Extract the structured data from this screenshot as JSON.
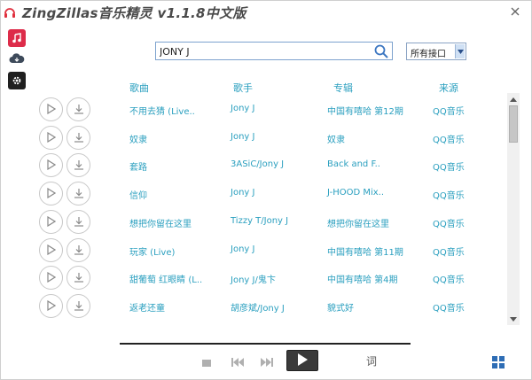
{
  "app": {
    "title": "ZingZillas音乐精灵 v1.1.8中文版",
    "accent": "#2a9fbf",
    "logo_icon": "headphones-icon",
    "close_icon": "close-icon"
  },
  "nav": {
    "items": [
      {
        "name": "music",
        "icon": "music-note-icon"
      },
      {
        "name": "cloud",
        "icon": "cloud-icon"
      },
      {
        "name": "settings",
        "icon": "gear-icon"
      }
    ]
  },
  "search": {
    "value": "JONY J",
    "placeholder": "",
    "icon": "search-icon"
  },
  "source_select": {
    "selected": "所有接口"
  },
  "table": {
    "headers": {
      "song": "歌曲",
      "artist": "歌手",
      "album": "专辑",
      "source": "来源"
    },
    "rows": [
      {
        "song": "不用去猜 (Live..",
        "artist": "Jony J",
        "album": "中国有嘻哈 第12期",
        "source": "QQ音乐"
      },
      {
        "song": "奴隶",
        "artist": "Jony J",
        "album": "奴隶",
        "source": "QQ音乐"
      },
      {
        "song": "套路",
        "artist": "3ASiC/Jony J",
        "album": "Back and F..",
        "source": "QQ音乐"
      },
      {
        "song": "信仰",
        "artist": "Jony J",
        "album": "J-HOOD Mix..",
        "source": "QQ音乐"
      },
      {
        "song": "想把你留在这里",
        "artist": "Tizzy T/Jony J",
        "album": "想把你留在这里",
        "source": "QQ音乐"
      },
      {
        "song": "玩家 (Live)",
        "artist": "Jony J",
        "album": "中国有嘻哈 第11期",
        "source": "QQ音乐"
      },
      {
        "song": "甜葡萄 红眼睛 (L..",
        "artist": "Jony J/鬼卞",
        "album": "中国有嘻哈 第4期",
        "source": "QQ音乐"
      },
      {
        "song": "返老还童",
        "artist": "胡彦斌/Jony J",
        "album": "貌式好",
        "source": "QQ音乐"
      }
    ]
  },
  "player": {
    "lyric_label": "词",
    "controls": [
      "stop-icon",
      "previous-icon",
      "next-icon",
      "play-icon",
      "grid-icon"
    ]
  }
}
